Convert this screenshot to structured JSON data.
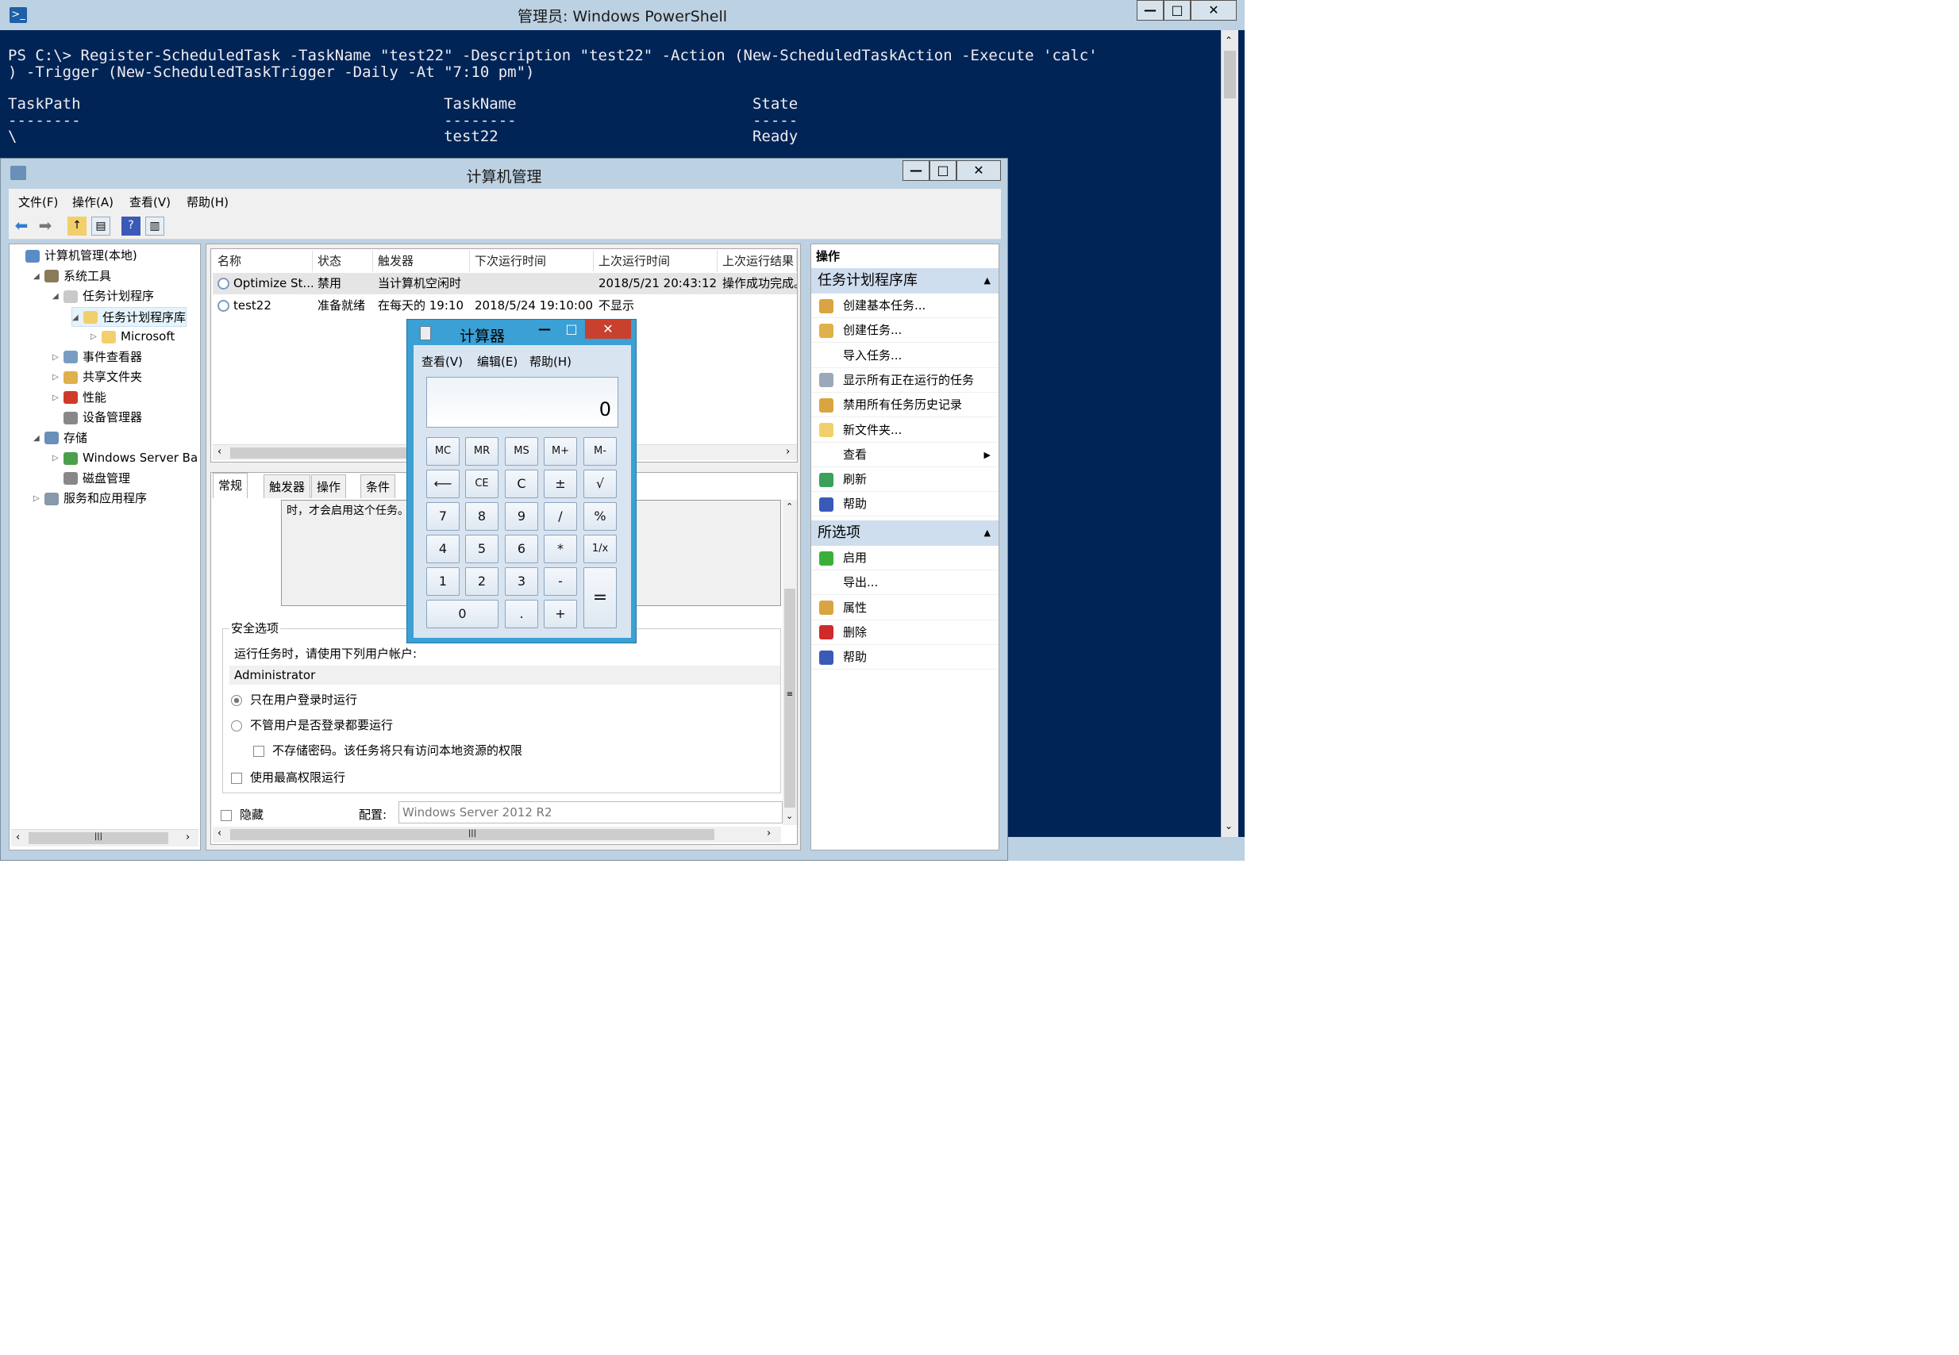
{
  "powershell": {
    "title": "管理员: Windows PowerShell",
    "lines": [
      "PS C:\\> Register-ScheduledTask -TaskName \"test22\" -Description \"test22\" -Action (New-ScheduledTaskAction -Execute 'calc'",
      ") -Trigger (New-ScheduledTaskTrigger -Daily -At \"7:10 pm\")",
      "",
      "TaskPath                                        TaskName                          State",
      "--------                                        --------                          -----",
      "\\                                               test22                            Ready"
    ]
  },
  "window_buttons": {
    "minimize": "—",
    "maximize": "□",
    "close": "✕"
  },
  "mmc": {
    "title": "计算机管理",
    "menu": [
      "文件(F)",
      "操作(A)",
      "查看(V)",
      "帮助(H)"
    ],
    "toolbar_icons": [
      "back-arrow-icon",
      "forward-arrow-icon",
      "up-folder-icon",
      "show-hide-tree-icon",
      "help-icon",
      "properties-pane-icon"
    ],
    "tree": [
      {
        "label": "计算机管理(本地)",
        "indent": 0,
        "expander": "",
        "icon": "computer-management-icon",
        "color": "#5b8bc4"
      },
      {
        "label": "系统工具",
        "indent": 1,
        "expander": "◢",
        "icon": "system-tools-icon",
        "color": "#8a7a5a"
      },
      {
        "label": "任务计划程序",
        "indent": 2,
        "expander": "◢",
        "icon": "clock-icon",
        "color": "#c9c9c9"
      },
      {
        "label": "任务计划程序库",
        "indent": 3,
        "expander": "◢",
        "icon": "folder-icon",
        "color": "#f2cf6b",
        "selected": true
      },
      {
        "label": "Microsoft",
        "indent": 4,
        "expander": "▷",
        "icon": "folder-icon",
        "color": "#f2cf6b"
      },
      {
        "label": "事件查看器",
        "indent": 2,
        "expander": "▷",
        "icon": "event-viewer-icon",
        "color": "#7a9cc2"
      },
      {
        "label": "共享文件夹",
        "indent": 2,
        "expander": "▷",
        "icon": "shared-folders-icon",
        "color": "#e0b04a"
      },
      {
        "label": "性能",
        "indent": 2,
        "expander": "▷",
        "icon": "performance-icon",
        "color": "#d03a2a"
      },
      {
        "label": "设备管理器",
        "indent": 2,
        "expander": "",
        "icon": "device-manager-icon",
        "color": "#888888"
      },
      {
        "label": "存储",
        "indent": 1,
        "expander": "◢",
        "icon": "storage-icon",
        "color": "#6a8fb8"
      },
      {
        "label": "Windows Server Back",
        "indent": 2,
        "expander": "▷",
        "icon": "backup-icon",
        "color": "#4aa04a"
      },
      {
        "label": "磁盘管理",
        "indent": 2,
        "expander": "",
        "icon": "disk-management-icon",
        "color": "#888888"
      },
      {
        "label": "服务和应用程序",
        "indent": 1,
        "expander": "▷",
        "icon": "services-icon",
        "color": "#8899aa"
      }
    ],
    "tasklist": {
      "columns": [
        "名称",
        "状态",
        "触发器",
        "下次运行时间",
        "上次运行时间",
        "上次运行结果"
      ],
      "rows": [
        [
          "Optimize St...",
          "禁用",
          "当计算机空闲时",
          "",
          "2018/5/21 20:43:12",
          "操作成功完成。"
        ],
        [
          "test22",
          "准备就绪",
          "在每天的 19:10",
          "2018/5/24 19:10:00",
          "不显示",
          ""
        ]
      ]
    },
    "detail": {
      "tabs": [
        "常规",
        "触发器",
        "操作",
        "条件"
      ],
      "description_fragment": "时，才会启用这个任务。",
      "security_group": "安全选项",
      "run_as_label": "运行任务时，请使用下列用户帐户:",
      "user": "Administrator",
      "radio_logged_on": "只在用户登录时运行",
      "radio_whether": "不管用户是否登录都要运行",
      "chk_no_password": "不存储密码。该任务将只有访问本地资源的权限",
      "chk_highest": "使用最高权限运行",
      "chk_hidden": "隐藏",
      "config_label": "配置:",
      "config_value": "Windows Server 2012 R2"
    },
    "actions_pane": {
      "header": "操作",
      "section1": "任务计划程序库",
      "items1": [
        {
          "label": "创建基本任务...",
          "icon": "create-basic-task-icon",
          "color": "#d9a441"
        },
        {
          "label": "创建任务...",
          "icon": "create-task-icon",
          "color": "#e0b04a"
        },
        {
          "label": "导入任务...",
          "icon": "",
          "color": ""
        },
        {
          "label": "显示所有正在运行的任务",
          "icon": "running-tasks-icon",
          "color": "#9aa9b8"
        },
        {
          "label": "禁用所有任务历史记录",
          "icon": "history-icon",
          "color": "#d9a441"
        },
        {
          "label": "新文件夹...",
          "icon": "new-folder-icon",
          "color": "#f2cf6b"
        },
        {
          "label": "查看",
          "icon": "",
          "color": "",
          "submenu": "▶"
        },
        {
          "label": "刷新",
          "icon": "refresh-icon",
          "color": "#3aa05a"
        },
        {
          "label": "帮助",
          "icon": "help-icon",
          "color": "#3a5ab8"
        }
      ],
      "section2": "所选项",
      "items2": [
        {
          "label": "启用",
          "icon": "enable-arrow-icon",
          "color": "#3ab03a"
        },
        {
          "label": "导出...",
          "icon": "",
          "color": ""
        },
        {
          "label": "属性",
          "icon": "properties-icon",
          "color": "#d9a441"
        },
        {
          "label": "删除",
          "icon": "delete-icon",
          "color": "#d02a2a"
        },
        {
          "label": "帮助",
          "icon": "help-icon",
          "color": "#3a5ab8"
        }
      ],
      "collapse_glyph": "▲"
    }
  },
  "calculator": {
    "title": "计算器",
    "menu": [
      "查看(V)",
      "编辑(E)",
      "帮助(H)"
    ],
    "display": "0",
    "buttons": [
      "MC",
      "MR",
      "MS",
      "M+",
      "M-",
      "⟵",
      "CE",
      "C",
      "±",
      "√",
      "7",
      "8",
      "9",
      "/",
      "%",
      "4",
      "5",
      "6",
      "*",
      "1/x",
      "1",
      "2",
      "3",
      "-",
      "=",
      "0",
      ".",
      "+"
    ]
  },
  "colors": {
    "powershell_bg": "#012456",
    "chrome": "#bcd1e2",
    "calc_frame": "#3aa0d5",
    "close_red": "#c8412f"
  }
}
